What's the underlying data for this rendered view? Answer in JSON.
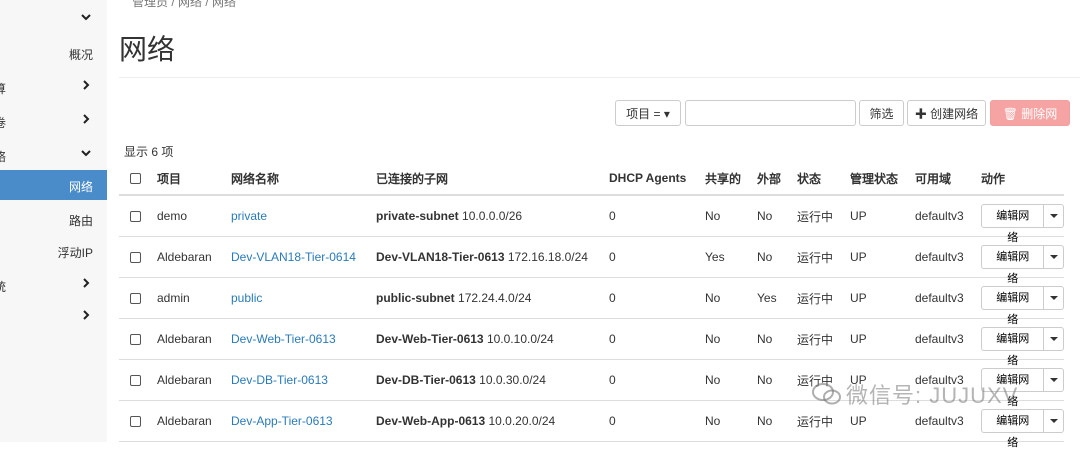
{
  "sidebar": {
    "items": [
      {
        "label": "",
        "chevron": "down"
      },
      {
        "label": "概况",
        "chevron": ""
      },
      {
        "label": "算",
        "chevron": "right"
      },
      {
        "label": "卷",
        "chevron": "right"
      },
      {
        "label": "络",
        "chevron": "down"
      },
      {
        "label": "网络",
        "chevron": ""
      },
      {
        "label": "路由",
        "chevron": ""
      },
      {
        "label": "浮动IP",
        "chevron": ""
      },
      {
        "label": "统",
        "chevron": "right"
      },
      {
        "label": "",
        "chevron": "right"
      }
    ]
  },
  "breadcrumb": "管理员 / 网络 / 网络",
  "page_title": "网络",
  "toolbar": {
    "filter_select": "项目 = ▾",
    "search_value": "",
    "filter_button": "筛选",
    "create_button": "✚ 创建网络",
    "delete_button": "🗑 删除网络"
  },
  "count_text": "显示 6 项",
  "table": {
    "headers": [
      "项目",
      "网络名称",
      "已连接的子网",
      "DHCP Agents",
      "共享的",
      "外部",
      "状态",
      "管理状态",
      "可用域",
      "动作"
    ],
    "rows": [
      {
        "project": "demo",
        "name": "private",
        "subnet_name": "private-subnet",
        "subnet_cidr": "10.0.0.0/26",
        "dhcp": "0",
        "shared": "No",
        "external": "No",
        "status": "运行中",
        "admin": "UP",
        "az": "defaultv3",
        "action": "编辑网络"
      },
      {
        "project": "Aldebaran",
        "name": "Dev-VLAN18-Tier-0614",
        "subnet_name": "Dev-VLAN18-Tier-0613",
        "subnet_cidr": "172.16.18.0/24",
        "dhcp": "0",
        "shared": "Yes",
        "external": "No",
        "status": "运行中",
        "admin": "UP",
        "az": "defaultv3",
        "action": "编辑网络"
      },
      {
        "project": "admin",
        "name": "public",
        "subnet_name": "public-subnet",
        "subnet_cidr": "172.24.4.0/24",
        "dhcp": "0",
        "shared": "No",
        "external": "Yes",
        "status": "运行中",
        "admin": "UP",
        "az": "defaultv3",
        "action": "编辑网络"
      },
      {
        "project": "Aldebaran",
        "name": "Dev-Web-Tier-0613",
        "subnet_name": "Dev-Web-Tier-0613",
        "subnet_cidr": "10.0.10.0/24",
        "dhcp": "0",
        "shared": "No",
        "external": "No",
        "status": "运行中",
        "admin": "UP",
        "az": "defaultv3",
        "action": "编辑网络"
      },
      {
        "project": "Aldebaran",
        "name": "Dev-DB-Tier-0613",
        "subnet_name": "Dev-DB-Tier-0613",
        "subnet_cidr": "10.0.30.0/24",
        "dhcp": "0",
        "shared": "No",
        "external": "No",
        "status": "运行中",
        "admin": "UP",
        "az": "defaultv3",
        "action": "编辑网络"
      },
      {
        "project": "Aldebaran",
        "name": "Dev-App-Tier-0613",
        "subnet_name": "Dev-Web-App-0613",
        "subnet_cidr": "10.0.20.0/24",
        "dhcp": "0",
        "shared": "No",
        "external": "No",
        "status": "运行中",
        "admin": "UP",
        "az": "defaultv3",
        "action": "编辑网络"
      }
    ]
  },
  "watermark": "微信号: JUJUXV",
  "colors": {
    "active": "#4a8bc9",
    "link": "#2a7ab9",
    "danger": "#f5a3a3"
  }
}
